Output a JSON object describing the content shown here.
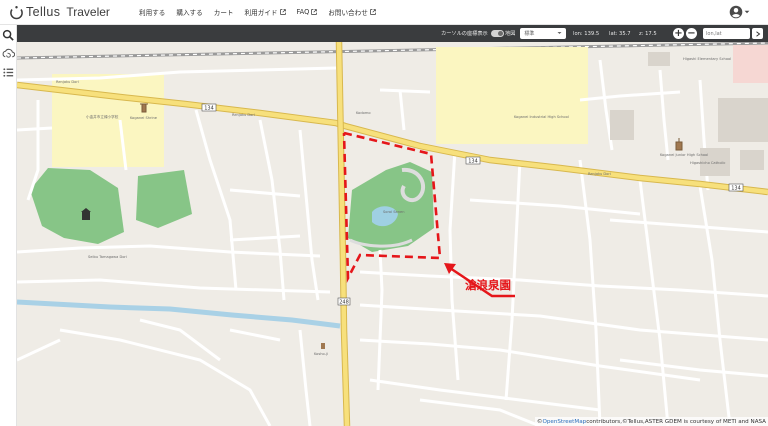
{
  "app": {
    "brand": "Tellus",
    "brand_sub": "Traveler"
  },
  "nav": {
    "items": [
      {
        "label": "利用する",
        "external": false
      },
      {
        "label": "購入する",
        "external": false
      },
      {
        "label": "カート",
        "external": false
      },
      {
        "label": "利用ガイド",
        "external": true
      },
      {
        "label": "FAQ",
        "external": true
      },
      {
        "label": "お問い合わせ",
        "external": true
      }
    ],
    "account_icon": "account-circle-icon"
  },
  "left_tools": [
    {
      "name": "search-icon"
    },
    {
      "name": "cloud-refresh-icon"
    },
    {
      "name": "layer-list-icon"
    }
  ],
  "map_toolbar": {
    "cursor_toggle_label": "カーソルの座標表示",
    "cursor_toggle_on": true,
    "map_label": "地図",
    "map_select_value": "標準",
    "lon": "lon: 139.5",
    "lat": "lat: 35.7",
    "zoom": "z: 17.5",
    "search_placeholder": "lon,lat"
  },
  "map": {
    "callout_label": "滄浪泉園",
    "labels": {
      "road_134_a": "134",
      "road_134_b": "134",
      "road_134_c": "134",
      "road_248": "248",
      "street_north": "Renjaku Dori",
      "street_mid": "Renjaku Dori",
      "street_east": "Renjaku Dori",
      "school_nw": "小金井市立緑小学校",
      "shrine": "Koganei Shrine",
      "building_ne": "Koganei Industrial High School",
      "school_ne": "Higashi Elementary School",
      "nursery_mid": "Kodomo",
      "park_label": "Soroi Senen",
      "building_east": "Koganei Junior High School",
      "building_east2": "Higashicho Catholic",
      "street_sw": "Seibu Tamagawa Dori",
      "temple_south": "Kosho-ji"
    },
    "attribution_link": "OpenStreetMap",
    "attribution_rest": " contributors,©Tellus,ASTER GDEM is courtesy of METI and NASA"
  },
  "colors": {
    "map_bg": "#efece6",
    "yellow_area": "#fbf6c1",
    "green": "#87c587",
    "road_yellow": "#f7e07c",
    "callout_red": "#e5161a",
    "toolbar": "#3a3c3e"
  }
}
